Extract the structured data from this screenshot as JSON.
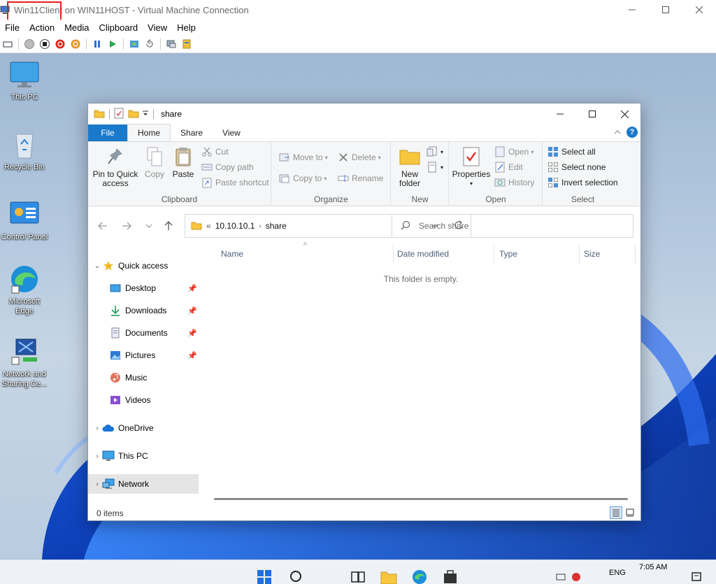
{
  "vm": {
    "title": "Win11Client on WIN11HOST - Virtual Machine Connection",
    "menu": [
      "File",
      "Action",
      "Media",
      "Clipboard",
      "View",
      "Help"
    ]
  },
  "desktop": {
    "icons": [
      {
        "label": "This PC",
        "icon": "monitor-icon"
      },
      {
        "label": "Recycle Bin",
        "icon": "recycle-bin-icon"
      },
      {
        "label": "Control Panel",
        "icon": "control-panel-icon"
      },
      {
        "label": "Microsoft Edge",
        "icon": "edge-icon"
      },
      {
        "label": "Network and Sharing Ce...",
        "icon": "network-sharing-icon"
      }
    ]
  },
  "explorer": {
    "title": "share",
    "tabs": [
      "File",
      "Home",
      "Share",
      "View"
    ],
    "active_tab": "Home",
    "ribbon": {
      "clipboard": {
        "label": "Clipboard",
        "pin": "Pin to Quick\naccess",
        "copy": "Copy",
        "paste": "Paste",
        "cut": "Cut",
        "copy_path": "Copy path",
        "paste_shortcut": "Paste shortcut"
      },
      "organize": {
        "label": "Organize",
        "move_to": "Move to",
        "copy_to": "Copy to",
        "delete": "Delete",
        "rename": "Rename"
      },
      "new": {
        "label": "New",
        "new_folder": "New\nfolder"
      },
      "open": {
        "label": "Open",
        "properties": "Properties",
        "open": "Open",
        "edit": "Edit",
        "history": "History"
      },
      "select": {
        "label": "Select",
        "select_all": "Select all",
        "select_none": "Select none",
        "invert": "Invert selection"
      }
    },
    "address": {
      "prefix": "«",
      "crumbs": [
        "10.10.10.1",
        "share"
      ]
    },
    "search_placeholder": "Search share",
    "nav": {
      "quick_access": "Quick access",
      "items": [
        "Desktop",
        "Downloads",
        "Documents",
        "Pictures",
        "Music",
        "Videos"
      ],
      "onedrive": "OneDrive",
      "this_pc": "This PC",
      "network": "Network"
    },
    "columns": [
      "Name",
      "Date modified",
      "Type",
      "Size"
    ],
    "empty_message": "This folder is empty.",
    "status": "0 items"
  },
  "taskbar": {
    "lang": "ENG",
    "time": "7:05 AM"
  },
  "colors": {
    "accent": "#1979ca",
    "highlight_box": "#e0201e"
  }
}
